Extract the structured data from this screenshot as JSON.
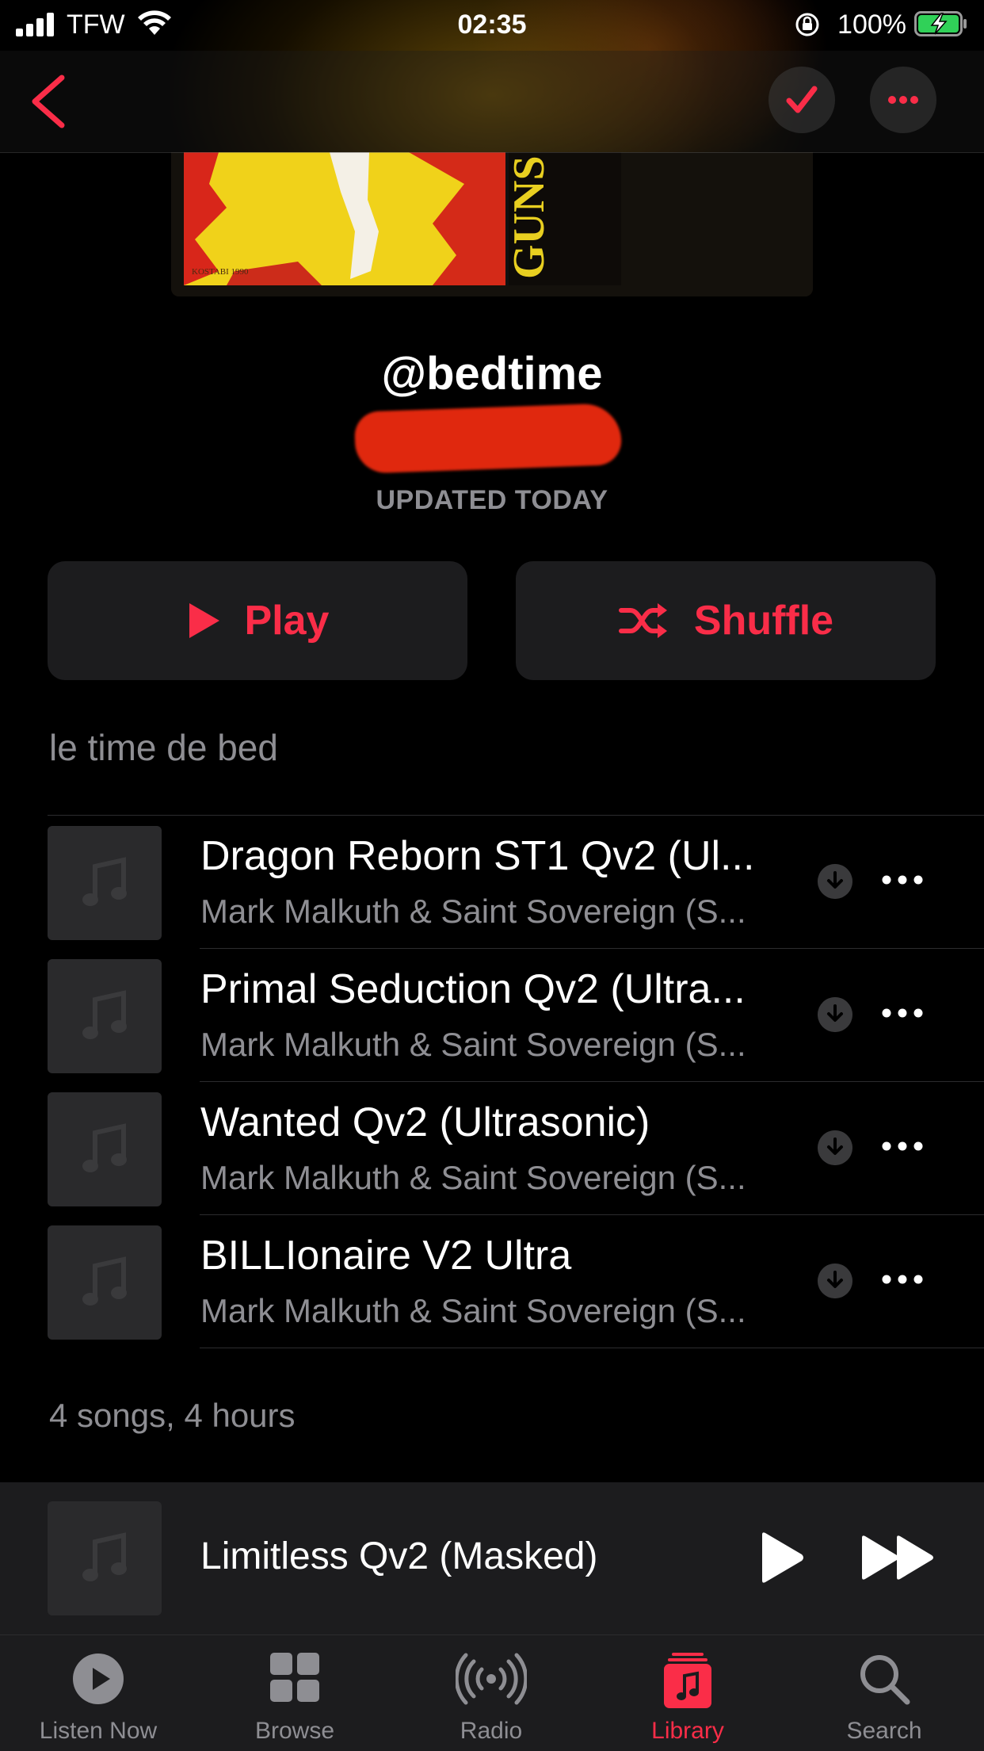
{
  "status_bar": {
    "carrier": "TFW",
    "time": "02:35",
    "battery": "100%"
  },
  "playlist": {
    "title": "@bedtime",
    "updated": "UPDATED TODAY",
    "description": "le time de bed",
    "play_label": "Play",
    "shuffle_label": "Shuffle",
    "summary": "4 songs, 4 hours"
  },
  "tracks": [
    {
      "title": "Dragon Reborn ST1 Qv2 (Ul...",
      "artist": "Mark Malkuth & Saint Sovereign (S..."
    },
    {
      "title": "Primal Seduction Qv2 (Ultra...",
      "artist": "Mark Malkuth & Saint Sovereign (S..."
    },
    {
      "title": "Wanted Qv2 (Ultrasonic)",
      "artist": "Mark Malkuth & Saint Sovereign (S..."
    },
    {
      "title": "BILLIonaire V2 Ultra",
      "artist": "Mark Malkuth & Saint Sovereign (S..."
    }
  ],
  "now_playing": {
    "title": "Limitless Qv2 (Masked)"
  },
  "tabs": [
    {
      "label": "Listen Now",
      "icon": "play-circle-icon"
    },
    {
      "label": "Browse",
      "icon": "grid-icon"
    },
    {
      "label": "Radio",
      "icon": "radio-waves-icon"
    },
    {
      "label": "Library",
      "icon": "library-icon",
      "active": true
    },
    {
      "label": "Search",
      "icon": "magnifier-icon"
    }
  ],
  "colors": {
    "accent": "#fa2d48",
    "background": "#000000",
    "surface": "#1c1c1e",
    "secondary_text": "#8e8e93"
  }
}
